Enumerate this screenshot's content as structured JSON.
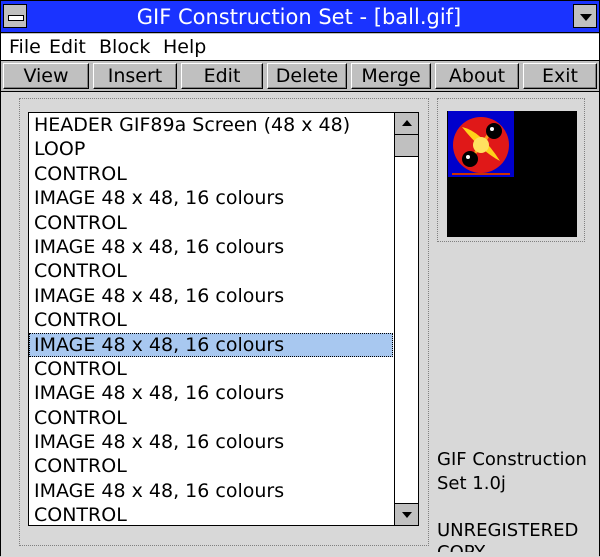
{
  "window": {
    "title": "GIF Construction Set - [ball.gif]"
  },
  "menu": {
    "items": [
      "File",
      "Edit",
      "Block",
      "Help"
    ]
  },
  "toolbar": {
    "buttons": [
      "View",
      "Insert",
      "Edit",
      "Delete",
      "Merge",
      "About",
      "Exit"
    ]
  },
  "blocks": {
    "items": [
      "HEADER GIF89a Screen (48 x 48)",
      "LOOP",
      "CONTROL",
      "IMAGE 48 x 48, 16 colours",
      "CONTROL",
      "IMAGE 48 x 48, 16 colours",
      "CONTROL",
      "IMAGE 48 x 48, 16 colours",
      "CONTROL",
      "IMAGE 48 x 48, 16 colours",
      "CONTROL",
      "IMAGE 48 x 48, 16 colours",
      "CONTROL",
      "IMAGE 48 x 48, 16 colours",
      "CONTROL",
      "IMAGE 48 x 48, 16 colours",
      "CONTROL"
    ],
    "selected_index": 9
  },
  "info": {
    "version_line1": "GIF Construction",
    "version_line2": "Set 1.0j",
    "unregistered": "UNREGISTERED",
    "copy": "COPY"
  },
  "colors": {
    "title_bar": "#1a33ff",
    "selection": "#a8c8f0",
    "window_bg": "#c0c0c0",
    "preview_bg": "#000000"
  }
}
